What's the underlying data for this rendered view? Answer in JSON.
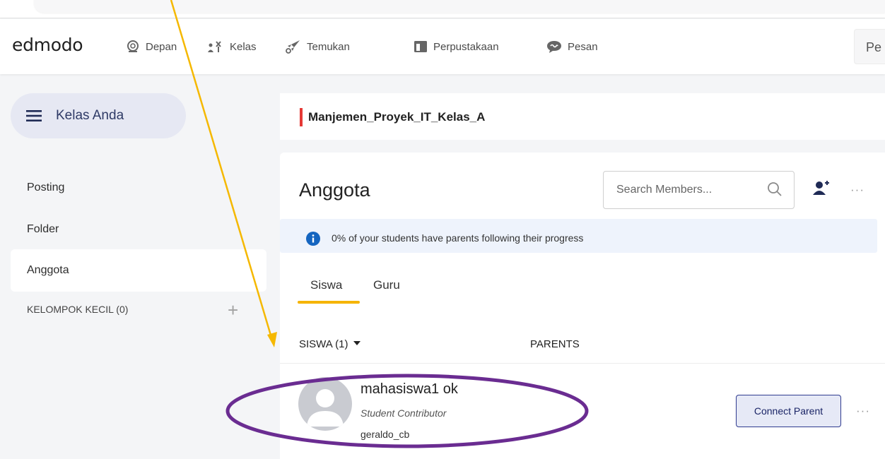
{
  "app": {
    "logo": "edmodo"
  },
  "nav": [
    {
      "label": "Depan",
      "icon": "globe-icon"
    },
    {
      "label": "Kelas",
      "icon": "class-icon"
    },
    {
      "label": "Temukan",
      "icon": "rocket-icon"
    },
    {
      "label": "Perpustakaan",
      "icon": "library-icon"
    },
    {
      "label": "Pesan",
      "icon": "message-icon"
    }
  ],
  "header_search": {
    "text": "Pe"
  },
  "sidebar": {
    "kelas_button": "Kelas Anda",
    "items": [
      {
        "label": "Posting"
      },
      {
        "label": "Folder"
      },
      {
        "label": "Anggota",
        "active": true
      }
    ],
    "small_groups": "KELOMPOK KECIL (0)"
  },
  "class": {
    "title": "Manjemen_Proyek_IT_Kelas_A",
    "accent": "#e53935"
  },
  "members": {
    "title": "Anggota",
    "search_placeholder": "Search Members...",
    "info": "0% of your students have parents following their progress",
    "tabs": [
      {
        "label": "Siswa",
        "active": true
      },
      {
        "label": "Guru"
      }
    ],
    "columns": {
      "students": "SISWA (1)",
      "parents": "PARENTS"
    },
    "rows": [
      {
        "name": "mahasiswa1 ok",
        "role": "Student Contributor",
        "username": "geraldo_cb",
        "action": "Connect Parent"
      }
    ]
  },
  "annotation_colors": {
    "arrow": "#f5b800",
    "ellipse": "#6a2c91",
    "tab_underline": "#f5b400"
  }
}
